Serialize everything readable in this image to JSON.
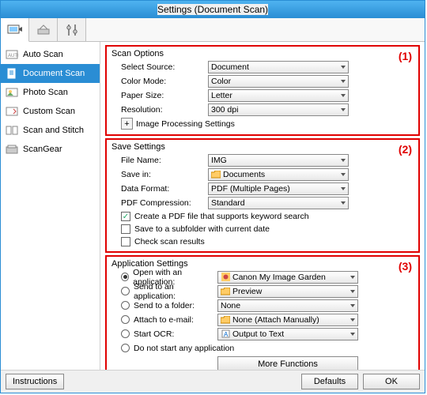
{
  "window": {
    "title": "Settings (Document Scan)"
  },
  "sidebar": {
    "items": [
      {
        "label": "Auto Scan"
      },
      {
        "label": "Document Scan"
      },
      {
        "label": "Photo Scan"
      },
      {
        "label": "Custom Scan"
      },
      {
        "label": "Scan and Stitch"
      },
      {
        "label": "ScanGear"
      }
    ]
  },
  "sections": {
    "scan": {
      "title": "Scan Options",
      "tag": "(1)",
      "rows": {
        "source": {
          "label": "Select Source:",
          "value": "Document"
        },
        "colormode": {
          "label": "Color Mode:",
          "value": "Color"
        },
        "papersize": {
          "label": "Paper Size:",
          "value": "Letter"
        },
        "resolution": {
          "label": "Resolution:",
          "value": "300 dpi"
        }
      },
      "expand": {
        "glyph": "+",
        "label": "Image Processing Settings"
      }
    },
    "save": {
      "title": "Save Settings",
      "tag": "(2)",
      "rows": {
        "filename": {
          "label": "File Name:",
          "value": "IMG"
        },
        "savein": {
          "label": "Save in:",
          "value": "Documents"
        },
        "dataformat": {
          "label": "Data Format:",
          "value": "PDF (Multiple Pages)"
        },
        "pdfcomp": {
          "label": "PDF Compression:",
          "value": "Standard"
        }
      },
      "checks": {
        "keyword": {
          "label": "Create a PDF file that supports keyword search",
          "checked": true
        },
        "subfolder": {
          "label": "Save to a subfolder with current date",
          "checked": false
        },
        "checkscan": {
          "label": "Check scan results",
          "checked": false
        }
      }
    },
    "app": {
      "title": "Application Settings",
      "tag": "(3)",
      "radios": {
        "openwith": {
          "label": "Open with an application:",
          "value": "Canon My Image Garden"
        },
        "sendapp": {
          "label": "Send to an application:",
          "value": "Preview"
        },
        "sendfolder": {
          "label": "Send to a folder:",
          "value": "None"
        },
        "attach": {
          "label": "Attach to e-mail:",
          "value": "None (Attach Manually)"
        },
        "ocr": {
          "label": "Start OCR:",
          "value": "Output to Text"
        },
        "donot": {
          "label": "Do not start any application"
        }
      },
      "morefns": "More Functions"
    }
  },
  "footer": {
    "instructions": "Instructions",
    "defaults": "Defaults",
    "ok": "OK"
  }
}
